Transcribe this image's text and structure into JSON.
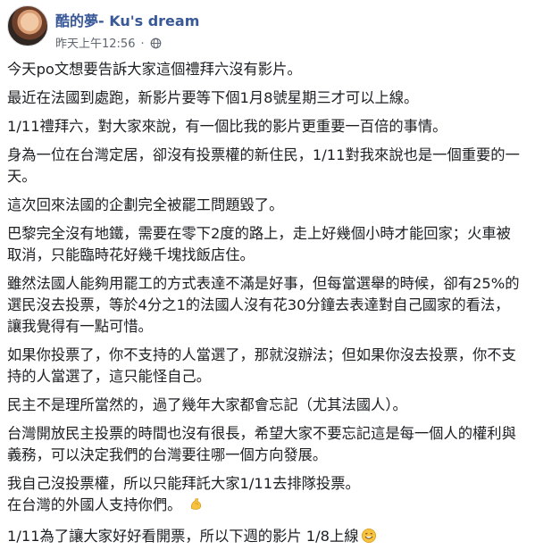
{
  "post": {
    "author": "酷的夢- Ku's dream",
    "timestamp": "昨天上午12:56",
    "separator": "·",
    "privacy_icon": "globe-icon",
    "paragraphs": [
      "今天po文想要告訴大家這個禮拜六沒有影片。",
      "最近在法國到處跑，新影片要等下個1月8號星期三才可以上線。",
      "1/11禮拜六，對大家來說，有一個比我的影片更重要一百倍的事情。",
      "身為一位在台灣定居，卻沒有投票權的新住民，1/11對我來說也是一個重要的一天。",
      "這次回來法國的企劃完全被罷工問題毀了。",
      "巴黎完全沒有地鐵，需要在零下2度的路上，走上好幾個小時才能回家；火車被取消，只能臨時花好幾千塊找飯店住。",
      "雖然法國人能夠用罷工的方式表達不滿是好事，但每當選舉的時候，卻有25%的選民沒去投票，等於4分之1的法國人沒有花30分鐘去表達對自己國家的看法，讓我覺得有一點可惜。",
      "如果你投票了，你不支持的人當選了，那就沒辦法；但如果你沒去投票，你不支持的人當選了，這只能怪自己。",
      "民主不是理所當然的，過了幾年大家都會忘記（尤其法國人）。",
      "台灣開放民主投票的時間也沒有很長，希望大家不要忘記這是每一個人的權利與義務，可以決定我們的台灣要往哪一個方向發展。"
    ],
    "para_11_line1": "我自己沒投票權，所以只能拜託大家1/11去排隊投票。",
    "para_11_line2": "在台灣的外國人支持你們。",
    "muscle_emoji_icon": "flexed-biceps-icon",
    "last_line": "1/11為了讓大家好好看開票，所以下週的影片 1/8上線",
    "smile_emoji_icon": "smiling-face-icon"
  }
}
